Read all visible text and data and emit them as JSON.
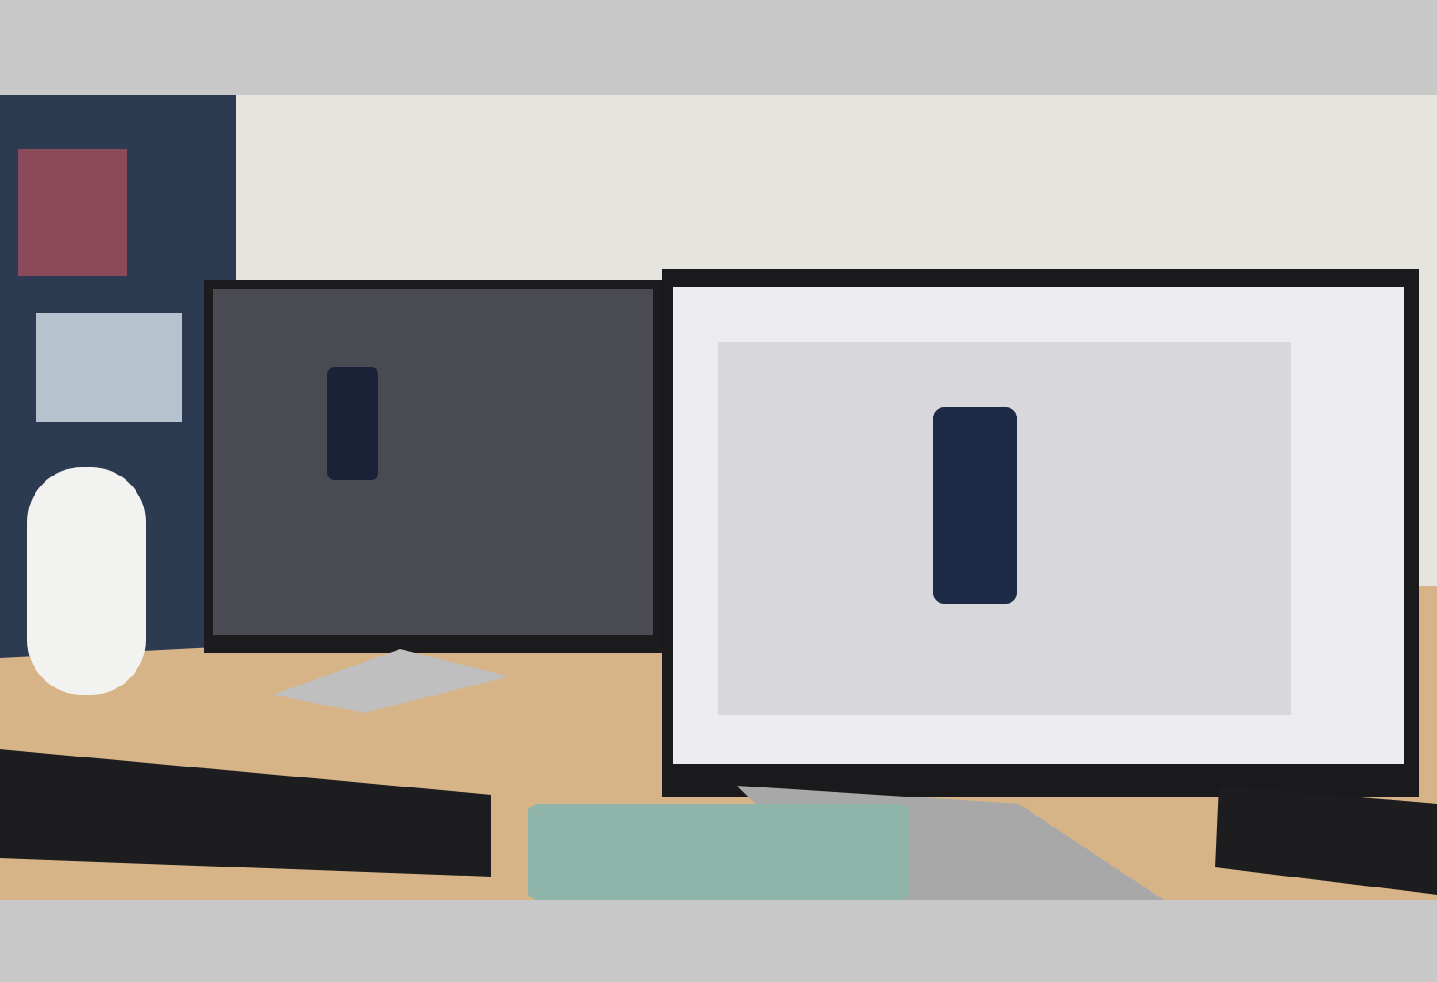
{
  "photo": {
    "kind": "desk-scene"
  }
}
